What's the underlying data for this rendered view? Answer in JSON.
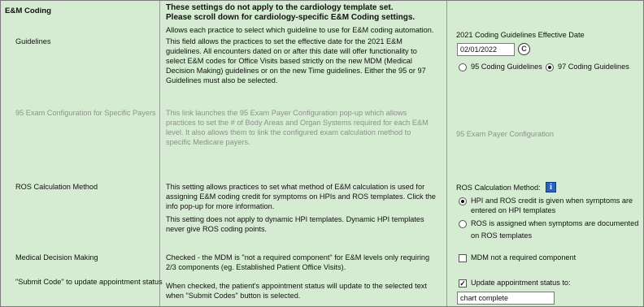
{
  "section_title": "E&M Coding",
  "notice_line1": "These settings do not apply to the cardiology template set.",
  "notice_line2": "Please scroll down for cardiology-specific E&M Coding settings.",
  "guidelines": {
    "label": "Guidelines",
    "intro": "Allows each practice to select which guideline to use for E&M coding automation.",
    "desc": [
      "This field allows the practices to set the effective date for the 2021 E&M",
      "guidelines. All encounters dated on or after this date will offer functionality to",
      "select E&M codes for Office Visits based strictly on the new MDM (Medical",
      "Decision Making) guidelines or on the new Time guidelines. Either the 95 or 97",
      "Guidelines must also be selected."
    ],
    "date_label": "2021 Coding Guidelines Effective Date",
    "date_value": "02/01/2022",
    "calendar_icon_glyph": "C",
    "option_95": "95 Coding Guidelines",
    "option_97": "97 Coding Guidelines",
    "selected": "97"
  },
  "exam_config": {
    "label": "95 Exam Configuration for Specific Payers",
    "desc": [
      "This link launches the 95 Exam Payer Configuration pop-up which allows",
      "practices to set the # of Body Areas and Organ Systems required for each E&M",
      "level. It also allows them to link the configured exam calculation method to",
      "specific Medicare payers."
    ],
    "link": "95 Exam Payer Configuration"
  },
  "ros": {
    "label": "ROS Calculation Method",
    "desc": [
      "This setting allows practices to set what method of E&M calculation is used for",
      "assigning E&M coding credit for symptoms on HPIs and ROS templates. Click the",
      "info pop-up for more information."
    ],
    "desc2": [
      "This setting does not apply to dynamic HPI templates.  Dynamic HPI templates",
      "never give ROS coding points."
    ],
    "method_label": "ROS Calculation Method:",
    "info_glyph": "i",
    "option1": [
      "HPI and ROS credit is given when symptoms are",
      "entered on HPI templates"
    ],
    "option2": [
      "ROS  is assigned when symptoms are documented",
      "on ROS templates"
    ],
    "selected": "option1"
  },
  "mdm": {
    "label": "Medical Decision Making",
    "desc": [
      "Checked - the MDM is \"not a required component\" for E&M levels only requiring",
      "2/3 components (eg. Established Patient Office Visits)."
    ],
    "checkbox_label": "MDM not a required component",
    "checked": false
  },
  "submit_code": {
    "label": "\"Submit Code\" to update appointment status",
    "desc": [
      "When checked, the patient's appointment status will update to the selected text",
      "when \"Submit Codes\" button is selected."
    ],
    "checkbox_label": "Update appointment status to:",
    "checked": true,
    "check_glyph": "✓",
    "status_value": "chart complete"
  }
}
